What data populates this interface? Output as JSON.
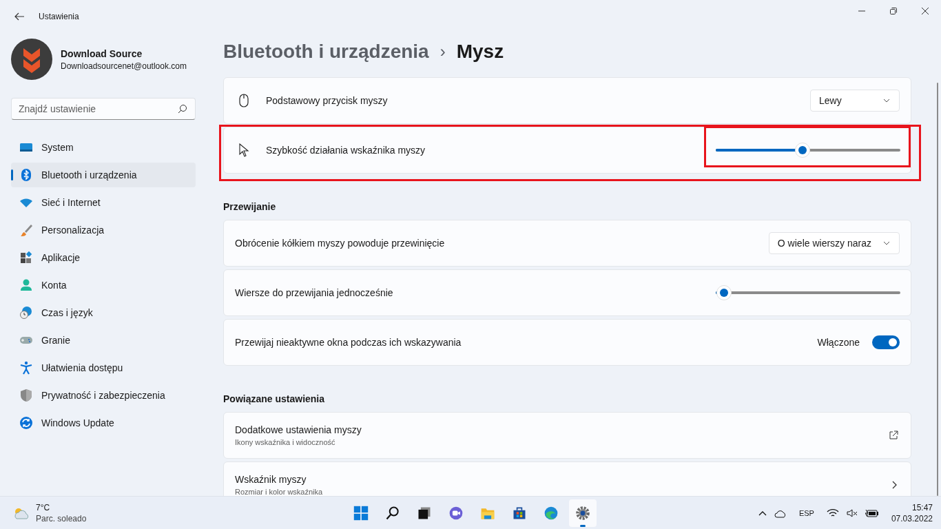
{
  "window": {
    "title": "Ustawienia"
  },
  "account": {
    "name": "Download Source",
    "email": "Downloadsourcenet@outlook.com"
  },
  "search": {
    "placeholder": "Znajdź ustawienie"
  },
  "sidebar": {
    "items": [
      {
        "label": "System",
        "selected": false
      },
      {
        "label": "Bluetooth i urządzenia",
        "selected": true
      },
      {
        "label": "Sieć i Internet",
        "selected": false
      },
      {
        "label": "Personalizacja",
        "selected": false
      },
      {
        "label": "Aplikacje",
        "selected": false
      },
      {
        "label": "Konta",
        "selected": false
      },
      {
        "label": "Czas i język",
        "selected": false
      },
      {
        "label": "Granie",
        "selected": false
      },
      {
        "label": "Ułatwienia dostępu",
        "selected": false
      },
      {
        "label": "Prywatność i zabezpieczenia",
        "selected": false
      },
      {
        "label": "Windows Update",
        "selected": false
      }
    ]
  },
  "breadcrumb": {
    "parent": "Bluetooth i urządzenia",
    "separator": "›",
    "current": "Mysz"
  },
  "sections": [
    {
      "rows": [
        {
          "kind": "dropdown",
          "label": "Podstawowy przycisk myszy",
          "value": "Lewy",
          "highlighted": false
        },
        {
          "kind": "slider",
          "label": "Szybkość działania wskaźnika myszy",
          "level": 0.47,
          "highlighted": true
        }
      ]
    },
    {
      "heading": "Przewijanie",
      "rows": [
        {
          "kind": "dropdown",
          "label": "Obrócenie kółkiem myszy powoduje przewinięcie",
          "value": "O wiele wierszy naraz",
          "highlighted": false
        },
        {
          "kind": "slider",
          "label": "Wiersze do przewijania jednocześnie",
          "level": 0.045,
          "highlighted": false
        },
        {
          "kind": "toggle",
          "label": "Przewijaj nieaktywne okna podczas ich wskazywania",
          "state_label": "Włączone",
          "on": true,
          "highlighted": false
        }
      ]
    },
    {
      "heading": "Powiązane ustawienia",
      "rows": [
        {
          "kind": "external",
          "label": "Dodatkowe ustawienia myszy",
          "sublabel": "Ikony wskaźnika i widoczność",
          "highlighted": false
        },
        {
          "kind": "link",
          "label": "Wskaźnik myszy",
          "sublabel": "Rozmiar i kolor wskaźnika",
          "highlighted": false
        }
      ]
    }
  ],
  "taskbar": {
    "weather": {
      "temp": "7°C",
      "condition": "Parc. soleado"
    },
    "apps": [
      {
        "selected": false
      },
      {
        "selected": false
      },
      {
        "selected": false
      },
      {
        "selected": false
      },
      {
        "selected": false
      },
      {
        "selected": false
      },
      {
        "selected": false
      },
      {
        "selected": true
      }
    ],
    "language": "ESP",
    "time": "15:47",
    "date": "07.03.2022"
  }
}
